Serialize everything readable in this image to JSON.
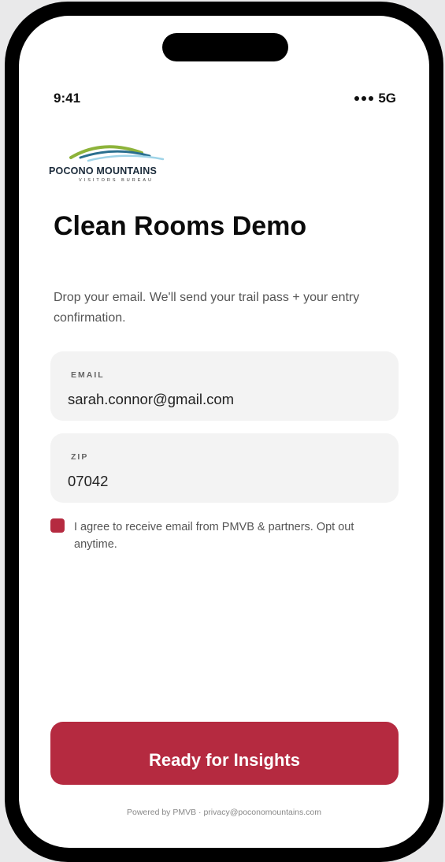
{
  "status_bar": {
    "time": "9:41",
    "network": "5G"
  },
  "logo": {
    "name": "POCONO MOUNTAINS",
    "tagline": "VISITORS BUREAU",
    "colors": [
      "#8db33a",
      "#2a6f8f",
      "#9fd4e8",
      "#1a2a3a"
    ]
  },
  "page": {
    "title": "Clean Rooms Demo",
    "subtitle": "Drop your email. We'll send your trail pass + your entry confirmation."
  },
  "form": {
    "email": {
      "label": "EMAIL",
      "value": "sarah.connor@gmail.com"
    },
    "zip": {
      "label": "ZIP",
      "value": "07042"
    },
    "consent": {
      "checked": true,
      "text": "I agree to receive email from PMVB & partners. Opt out anytime."
    }
  },
  "cta": {
    "label": "Ready for Insights"
  },
  "footer": {
    "text": "Powered by PMVB · privacy@poconomountains.com"
  },
  "colors": {
    "accent": "#b52a40",
    "field_bg": "#f3f3f3"
  }
}
